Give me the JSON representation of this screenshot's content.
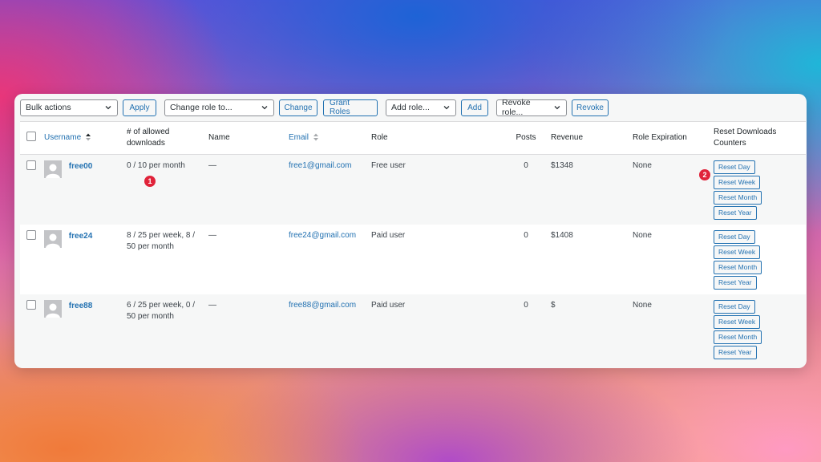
{
  "toolbar": {
    "bulk_actions": "Bulk actions",
    "apply": "Apply",
    "change_role": "Change role to...",
    "change": "Change",
    "grant_roles": "Grant Roles",
    "add_role": "Add role...",
    "add": "Add",
    "revoke_role": "Revoke role...",
    "revoke": "Revoke"
  },
  "columns": {
    "username": "Username",
    "allowed_line1": "# of allowed",
    "allowed_line2": "downloads",
    "name": "Name",
    "email": "Email",
    "role": "Role",
    "posts": "Posts",
    "revenue": "Revenue",
    "role_expiration": "Role Expiration",
    "reset_line1": "Reset Downloads",
    "reset_line2": "Counters"
  },
  "rows": [
    {
      "username": "free00",
      "allowed_line1": "0 / 10 per month",
      "allowed_line2": "",
      "name": "—",
      "email": "free1@gmail.com",
      "role": "Free user",
      "posts": "0",
      "revenue": "$1348",
      "expiration": "None"
    },
    {
      "username": "free24",
      "allowed_line1": "8 / 25 per week, 8 /",
      "allowed_line2": "50 per month",
      "name": "—",
      "email": "free24@gmail.com",
      "role": "Paid user",
      "posts": "0",
      "revenue": "$1408",
      "expiration": "None"
    },
    {
      "username": "free88",
      "allowed_line1": "6 / 25 per week, 0 /",
      "allowed_line2": "50 per month",
      "name": "—",
      "email": "free88@gmail.com",
      "role": "Paid user",
      "posts": "0",
      "revenue": "$",
      "expiration": "None"
    }
  ],
  "reset_buttons": {
    "day": "Reset Day",
    "week": "Reset Week",
    "month": "Reset Month",
    "year": "Reset Year"
  },
  "badges": {
    "one": "1",
    "two": "2"
  },
  "colors": {
    "accent": "#2271b1",
    "badge": "#e0233a"
  }
}
